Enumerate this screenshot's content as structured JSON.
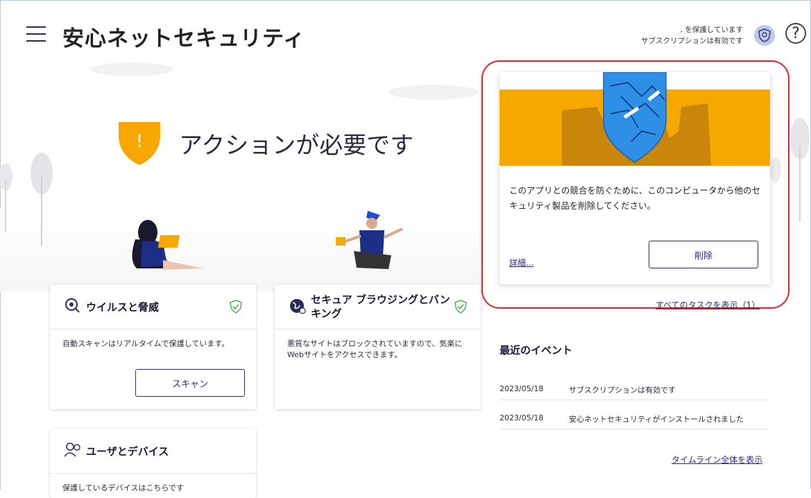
{
  "header": {
    "app_title": "安心ネットセキュリティ",
    "status_line1": ", を保護しています",
    "status_line2": "サブスクリプションは有効です",
    "help_symbol": "?"
  },
  "alert": {
    "symbol": "!",
    "title": "アクションが必要です",
    "color": "#f7a800"
  },
  "cards": {
    "virus": {
      "title": "ウイルスと脅威",
      "description": "自動スキャンはリアルタイムで保護しています。",
      "button": "スキャン"
    },
    "browsing": {
      "title_line1": "セキュア ブラウジングとバン",
      "title_line2": "キング",
      "description_line1": "悪質なサイトはブロックされていますので、気楽に",
      "description_line2": "Webサイトをアクセスできます。"
    },
    "users": {
      "title": "ユーザとデバイス",
      "description": "保護しているデバイスはこちらです"
    }
  },
  "popup": {
    "message_line1": "このアプリとの競合を防ぐために、このコンピュータから他のセ",
    "message_line2": "キュリティ製品を削除してください。",
    "details_link": "詳細...",
    "remove_button": "削除"
  },
  "tasks": {
    "all_tasks_link": "すべてのタスクを表示（1）"
  },
  "events": {
    "title": "最近のイベント",
    "rows": [
      {
        "date": "2023/05/18",
        "text": "サブスクリプションは有効です"
      },
      {
        "date": "2023/05/18",
        "text": "安心ネットセキュリティがインストールされました"
      }
    ],
    "timeline_link": "タイムライン全体を表示"
  },
  "colors": {
    "accent": "#2b2b7a",
    "warning": "#f7a800",
    "shield_blue": "#2d8fe6",
    "check_green": "#4caf50",
    "highlight_ring": "#e0202c"
  }
}
